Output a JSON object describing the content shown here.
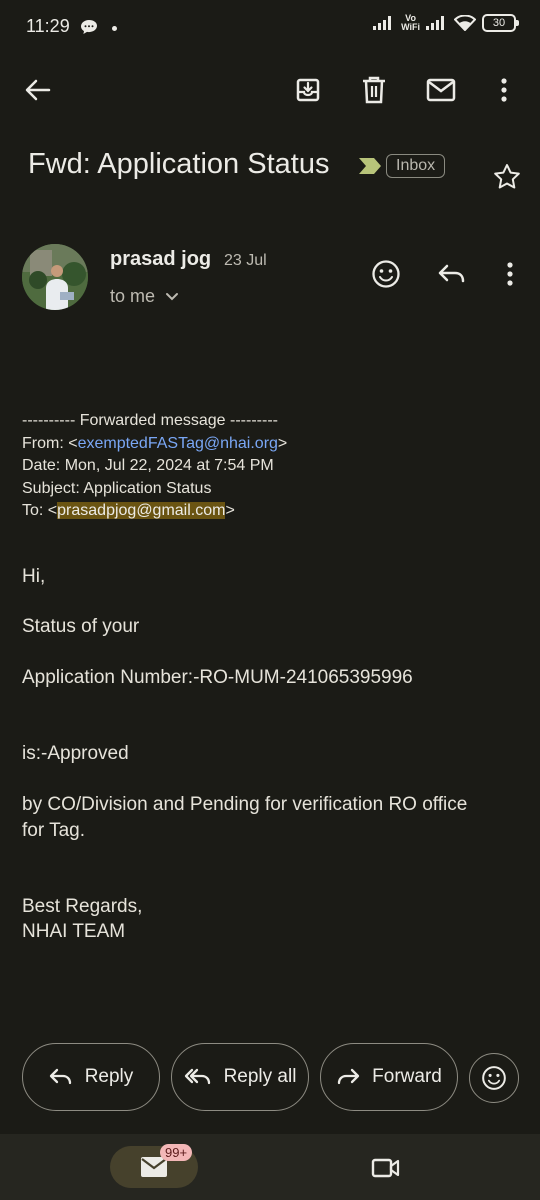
{
  "status_bar": {
    "time": "11:29",
    "battery": "30",
    "vowifi_top": "Vo",
    "vowifi_bottom": "WiFi"
  },
  "toolbar": {
    "icons": [
      "back-arrow-icon",
      "archive-icon",
      "delete-icon",
      "mark-unread-icon",
      "more-vert-icon"
    ]
  },
  "email": {
    "subject": "Fwd: Application Status",
    "label": "Inbox",
    "sender": "prasad jog",
    "date": "23 Jul",
    "recipient": "to me",
    "forward": {
      "line1": "---------- Forwarded message ---------",
      "from_prefix": "From: <",
      "from_email": "exemptedFASTag@nhai.org",
      "from_suffix": ">",
      "date_line": "Date: Mon, Jul 22, 2024 at 7:54 PM",
      "subject_line": "Subject: Application Status",
      "to_prefix": "To: <",
      "to_email": "prasadpjog@gmail.com",
      "to_suffix": ">"
    },
    "body": {
      "greeting": "Hi,",
      "status_of": "Status of your",
      "app_number": "Application Number:-RO-MUM-241065395996",
      "is_approved": "is:-Approved",
      "by_line1": "by CO/Division and Pending for verification RO office",
      "by_line2": "for Tag.",
      "regards": "Best Regards,",
      "team": "NHAI TEAM"
    }
  },
  "actions": {
    "reply": "Reply",
    "reply_all": "Reply all",
    "forward": "Forward"
  },
  "bottom_nav": {
    "mail_badge": "99+"
  },
  "colors": {
    "background": "#1b1b16",
    "link": "#7aa7f5",
    "highlight": "#6a5412",
    "important_marker": "#b8c47a"
  }
}
